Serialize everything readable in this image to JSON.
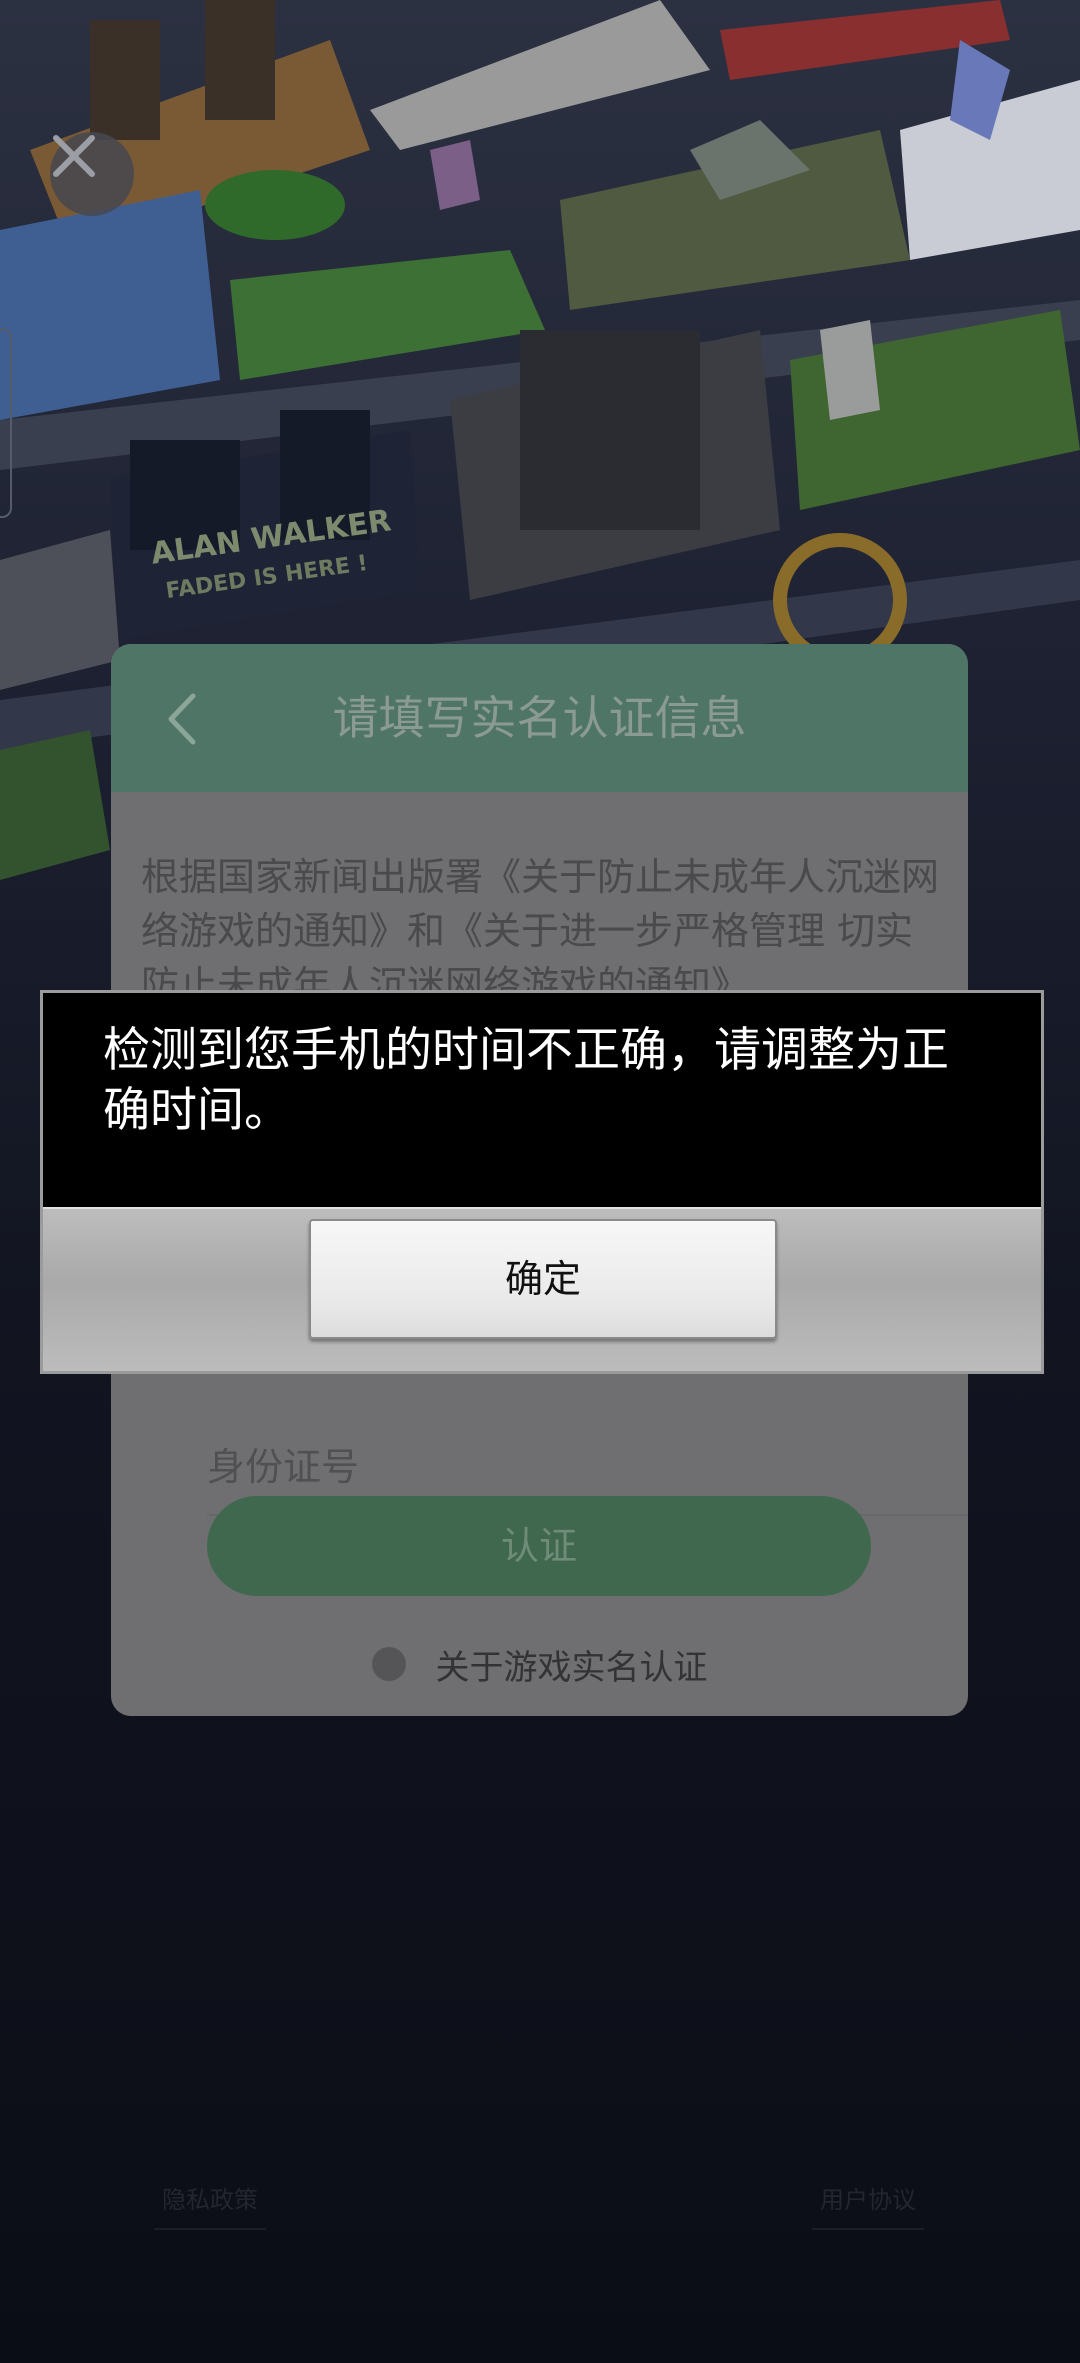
{
  "background": {
    "close_icon": "close-icon",
    "level_banner_line1": "ALAN WALKER",
    "level_banner_line2": "FADED IS HERE !"
  },
  "auth_panel": {
    "back_icon": "chevron-left-icon",
    "title": "请填写实名认证信息",
    "notice": "根据国家新闻出版署《关于防止未成年人沉迷网络游戏的通知》和《关于进一步严格管理 切实防止未成年人沉迷网络游戏的通知》",
    "id_field_placeholder": "身份证号",
    "verify_button": "认证",
    "info_icon": "info-icon",
    "about_link": "关于游戏实名认证"
  },
  "footer": {
    "privacy_policy": "隐私政策",
    "user_agreement": "用户协议"
  },
  "alert": {
    "message": "检测到您手机的时间不正确，请调整为正确时间。",
    "ok_button": "确定"
  },
  "colors": {
    "alert_background": "#000000",
    "alert_button_bar": "#b5b5b5",
    "panel_header": "#4e7566",
    "verify_button": "#40684e"
  }
}
